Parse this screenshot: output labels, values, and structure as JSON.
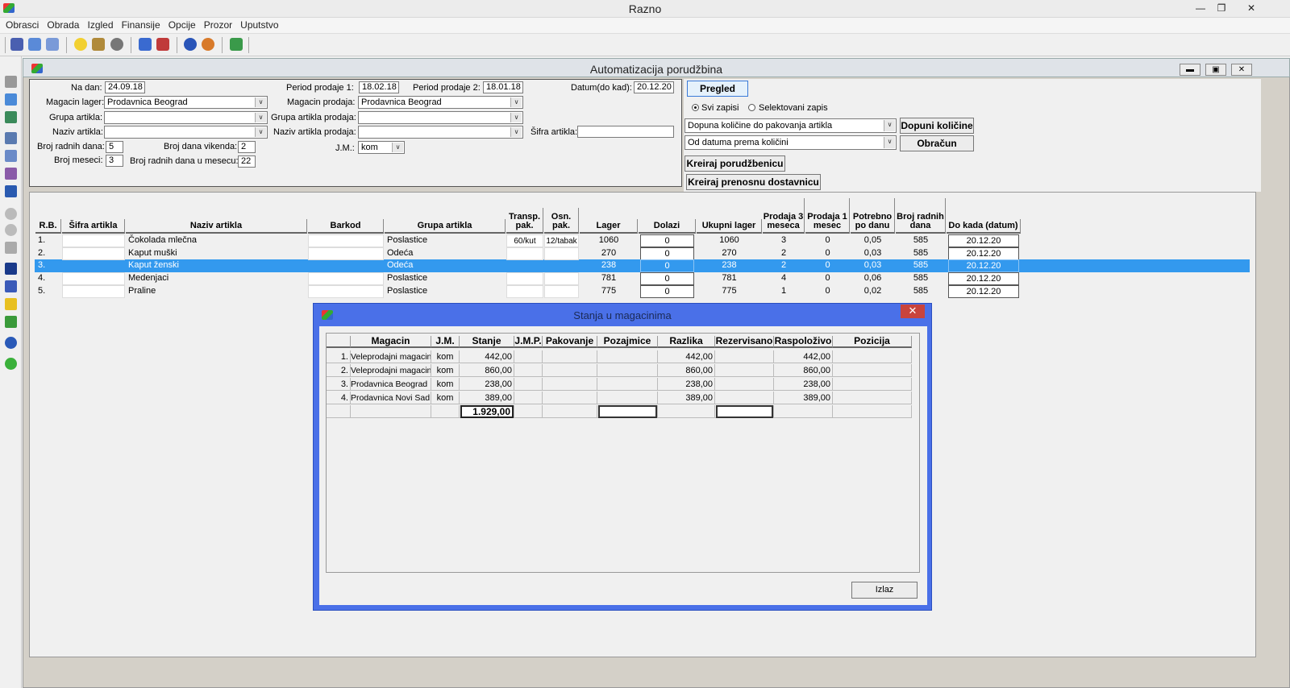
{
  "app": {
    "title": "Razno",
    "win_minimize": "—",
    "win_restore": "❐",
    "win_close": "✕"
  },
  "menu": [
    "Obrasci",
    "Obrada",
    "Izgled",
    "Finansije",
    "Opcije",
    "Prozor",
    "Uputstvo"
  ],
  "child": {
    "title": "Automatizacija porudžbina"
  },
  "filters": {
    "na_dan_label": "Na dan:",
    "na_dan": "24.09.18",
    "period1_label": "Period prodaje 1:",
    "period1": "18.02.18",
    "period2_label": "Period prodaje 2:",
    "period2": "18.01.18",
    "datum_label": "Datum(do kad):",
    "datum": "20.12.20",
    "magacin_lager_label": "Magacin lager:",
    "magacin_lager": "Prodavnica Beograd",
    "magacin_prodaja_label": "Magacin prodaja:",
    "magacin_prodaja": "Prodavnica Beograd",
    "grupa_label": "Grupa artikla:",
    "grupa": "",
    "grupa_prodaja_label": "Grupa artikla prodaja:",
    "grupa_prodaja": "",
    "naziv_label": "Naziv artikla:",
    "naziv": "",
    "naziv_prodaja_label": "Naziv artikla prodaja:",
    "naziv_prodaja": "",
    "sifra_label": "Šifra artikla:",
    "sifra": "",
    "radni_dani_label": "Broj radnih dana:",
    "radni_dani": "5",
    "vikend_label": "Broj dana vikenda:",
    "vikend": "2",
    "jm_label": "J.M.:",
    "jm": "kom",
    "meseci_label": "Broj meseci:",
    "meseci": "3",
    "radni_mesec_label": "Broj radnih dana u mesecu:",
    "radni_mesec": "22"
  },
  "actions": {
    "pregled": "Pregled",
    "radio_svi": "Svi zapisi",
    "radio_sel": "Selektovani zapis",
    "combo1": "Dopuna količine do pakovanja artikla",
    "combo2": "Od datuma prema količini",
    "dopuni": "Dopuni količine",
    "obracun": "Obračun",
    "kreiraj_por": "Kreiraj porudžbenicu",
    "kreiraj_pren": "Kreiraj prenosnu dostavnicu"
  },
  "grid": {
    "headers": [
      "R.B.",
      "Šifra artikla",
      "Naziv artikla",
      "Barkod",
      "Grupa artikla",
      "Transp. pak.",
      "Osn. pak.",
      "Lager",
      "Dolazi",
      "Ukupni lager",
      "Prodaja 3 meseca",
      "Prodaja 1 mesec",
      "Potrebno po danu",
      "Broj radnih dana",
      "Do kada (datum)"
    ],
    "rows": [
      [
        "1.",
        "",
        "Čokolada mlečna",
        "",
        "Poslastice",
        "60/kut",
        "12/tabak",
        "1060",
        "0",
        "1060",
        "3",
        "0",
        "0,05",
        "585",
        "20.12.20"
      ],
      [
        "2.",
        "",
        "Kaput muški",
        "",
        "Odeća",
        "",
        "",
        "270",
        "0",
        "270",
        "2",
        "0",
        "0,03",
        "585",
        "20.12.20"
      ],
      [
        "3.",
        "",
        "Kaput ženski",
        "",
        "Odeća",
        "",
        "",
        "238",
        "0",
        "238",
        "2",
        "0",
        "0,03",
        "585",
        "20.12.20"
      ],
      [
        "4.",
        "",
        "Medenjaci",
        "",
        "Poslastice",
        "",
        "",
        "781",
        "0",
        "781",
        "4",
        "0",
        "0,06",
        "585",
        "20.12.20"
      ],
      [
        "5.",
        "",
        "Praline",
        "",
        "Poslastice",
        "",
        "",
        "775",
        "0",
        "775",
        "1",
        "0",
        "0,02",
        "585",
        "20.12.20"
      ]
    ]
  },
  "dialog": {
    "title": "Stanja u magacinima",
    "close": "✕",
    "headers": [
      "Magacin",
      "J.M.",
      "Stanje",
      "J.M.P.",
      "Pakovanje",
      "Pozajmice",
      "Razlika",
      "Rezervisano",
      "Raspoloživo",
      "Pozicija"
    ],
    "rows": [
      [
        "1.",
        "Veleprodajni magacin",
        "kom",
        "442,00",
        "",
        "",
        "",
        "442,00",
        "",
        "442,00",
        ""
      ],
      [
        "2.",
        "Veleprodajni magacin",
        "kom",
        "860,00",
        "",
        "",
        "",
        "860,00",
        "",
        "860,00",
        ""
      ],
      [
        "3.",
        "Prodavnica Beograd",
        "kom",
        "238,00",
        "",
        "",
        "",
        "238,00",
        "",
        "238,00",
        ""
      ],
      [
        "4.",
        "Prodavnica Novi Sad",
        "kom",
        "389,00",
        "",
        "",
        "",
        "389,00",
        "",
        "389,00",
        ""
      ]
    ],
    "total": "1.929,00",
    "izlaz": "Izlaz"
  },
  "colors": {
    "selection": "#3399ee",
    "dialog_frame": "#4a70e8",
    "close_red": "#c9443c"
  }
}
